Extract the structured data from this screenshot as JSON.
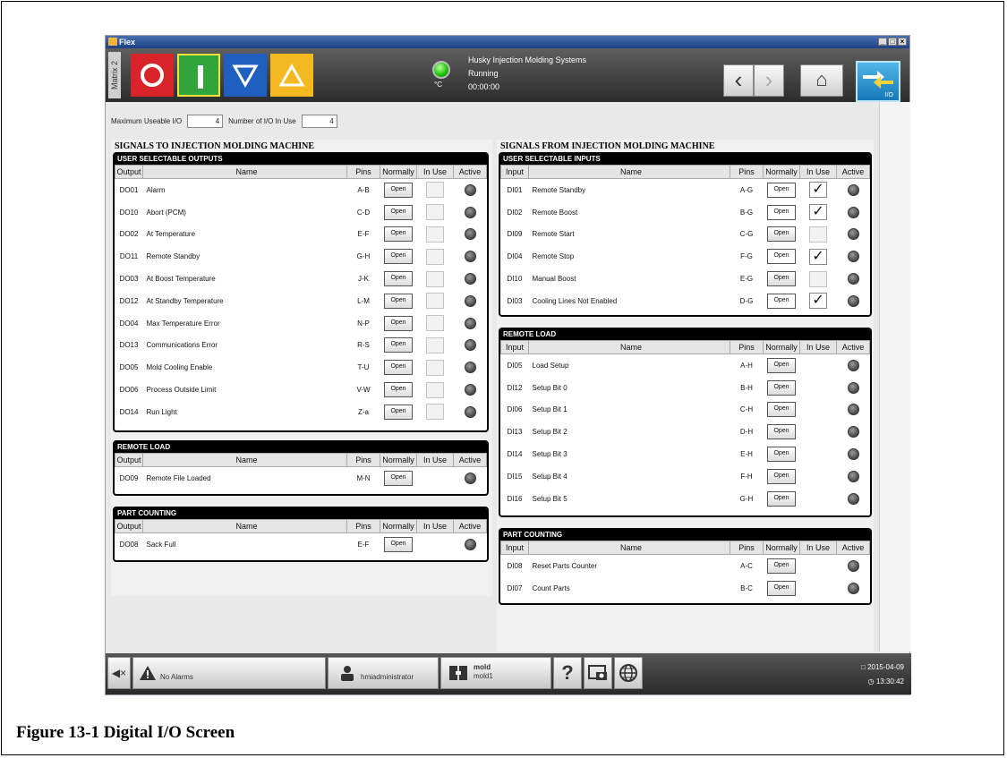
{
  "window": {
    "title": "Flex"
  },
  "topbar": {
    "matrix_label": "Matrix 2",
    "temp_unit": "°C",
    "company": "Husky Injection Molding Systems",
    "status": "Running",
    "time": "00:00:00",
    "io_label": "I/O"
  },
  "info": {
    "max_label": "Maximum Useable I/O",
    "max_value": "4",
    "inuse_label": "Number of I/O In Use",
    "inuse_value": "4"
  },
  "left": {
    "title": "SIGNALS TO INJECTION MOLDING MACHINE",
    "outputs": {
      "header": "USER SELECTABLE OUTPUTS",
      "columns": [
        "Output",
        "Name",
        "Pins",
        "Normally",
        "In Use",
        "Active"
      ],
      "rows": [
        {
          "id": "DO01",
          "name": "Alarm",
          "pins": "A-B",
          "normally": "Open"
        },
        {
          "id": "DO10",
          "name": "Abort (PCM)",
          "pins": "C-D",
          "normally": "Open"
        },
        {
          "id": "DO02",
          "name": "At Temperature",
          "pins": "E-F",
          "normally": "Open"
        },
        {
          "id": "DO11",
          "name": "Remote Standby",
          "pins": "G-H",
          "normally": "Open"
        },
        {
          "id": "DO03",
          "name": "At Boost Temperature",
          "pins": "J-K",
          "normally": "Open"
        },
        {
          "id": "DO12",
          "name": "At Standby Temperature",
          "pins": "L-M",
          "normally": "Open"
        },
        {
          "id": "DO04",
          "name": "Max Temperature Error",
          "pins": "N-P",
          "normally": "Open"
        },
        {
          "id": "DO13",
          "name": "Communications Error",
          "pins": "R-S",
          "normally": "Open"
        },
        {
          "id": "DO05",
          "name": "Mold Cooling Enable",
          "pins": "T-U",
          "normally": "Open"
        },
        {
          "id": "DO06",
          "name": "Process Outside Limit",
          "pins": "V-W",
          "normally": "Open"
        },
        {
          "id": "DO14",
          "name": "Run Light",
          "pins": "Z-a",
          "normally": "Open"
        }
      ]
    },
    "remote_load": {
      "header": "REMOTE LOAD",
      "columns": [
        "Output",
        "Name",
        "Pins",
        "Normally",
        "In Use",
        "Active"
      ],
      "rows": [
        {
          "id": "DO09",
          "name": "Remote File Loaded",
          "pins": "M-N",
          "normally": "Open"
        }
      ]
    },
    "part_counting": {
      "header": "PART COUNTING",
      "columns": [
        "Output",
        "Name",
        "Pins",
        "Normally",
        "In Use",
        "Active"
      ],
      "rows": [
        {
          "id": "DO08",
          "name": "Sack Full",
          "pins": "E-F",
          "normally": "Open"
        }
      ]
    }
  },
  "right": {
    "title": "SIGNALS FROM INJECTION MOLDING MACHINE",
    "inputs": {
      "header": "USER SELECTABLE INPUTS",
      "columns": [
        "Input",
        "Name",
        "Pins",
        "Normally",
        "In Use",
        "Active"
      ],
      "rows": [
        {
          "id": "DI01",
          "name": "Remote Standby",
          "pins": "A-G",
          "normally": "Open",
          "in_use": true
        },
        {
          "id": "DI02",
          "name": "Remote Boost",
          "pins": "B-G",
          "normally": "Open",
          "in_use": true
        },
        {
          "id": "DI09",
          "name": "Remote Start",
          "pins": "C-G",
          "normally": "Open",
          "in_use": false
        },
        {
          "id": "DI04",
          "name": "Remote Stop",
          "pins": "F-G",
          "normally": "Open",
          "in_use": true
        },
        {
          "id": "DI10",
          "name": "Manual Boost",
          "pins": "E-G",
          "normally": "Open",
          "in_use": false
        },
        {
          "id": "DI03",
          "name": "Cooling Lines Not Enabled",
          "pins": "D-G",
          "normally": "Open",
          "in_use": true
        }
      ]
    },
    "remote_load": {
      "header": "REMOTE LOAD",
      "columns": [
        "Input",
        "Name",
        "Pins",
        "Normally",
        "In Use",
        "Active"
      ],
      "rows": [
        {
          "id": "DI05",
          "name": "Load Setup",
          "pins": "A-H",
          "normally": "Open"
        },
        {
          "id": "DI12",
          "name": "Setup Bit 0",
          "pins": "B-H",
          "normally": "Open"
        },
        {
          "id": "DI06",
          "name": "Setup Bit 1",
          "pins": "C-H",
          "normally": "Open"
        },
        {
          "id": "DI13",
          "name": "Setup Bit 2",
          "pins": "D-H",
          "normally": "Open"
        },
        {
          "id": "DI14",
          "name": "Setup Bit 3",
          "pins": "E-H",
          "normally": "Open"
        },
        {
          "id": "DI15",
          "name": "Setup Bit 4",
          "pins": "F-H",
          "normally": "Open"
        },
        {
          "id": "DI16",
          "name": "Setup Bit 5",
          "pins": "G-H",
          "normally": "Open"
        }
      ]
    },
    "part_counting": {
      "header": "PART COUNTING",
      "columns": [
        "Input",
        "Name",
        "Pins",
        "Normally",
        "In Use",
        "Active"
      ],
      "rows": [
        {
          "id": "DI08",
          "name": "Reset Parts Counter",
          "pins": "A-C",
          "normally": "Open"
        },
        {
          "id": "DI07",
          "name": "Count Parts",
          "pins": "B-C",
          "normally": "Open"
        }
      ]
    }
  },
  "bottombar": {
    "alarms": "No Alarms",
    "user": "hmiadministrator",
    "mold_title": "mold",
    "mold_name": "mold1",
    "date": "2015-04-09",
    "clock": "13:30:42"
  },
  "caption": "Figure 13-1 Digital I/O Screen"
}
